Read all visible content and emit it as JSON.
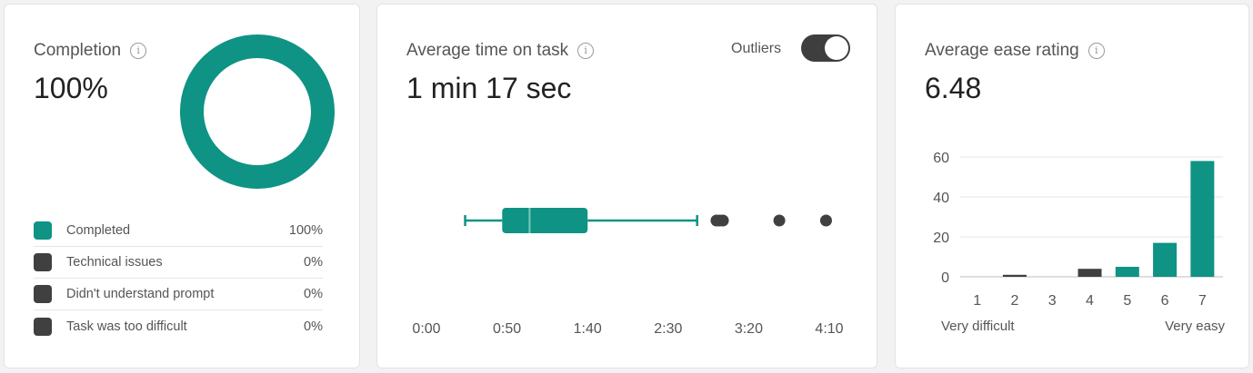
{
  "completion": {
    "title": "Completion",
    "value": "100%",
    "percent": 100,
    "legend": [
      {
        "label": "Completed",
        "value": "100%",
        "color": "#0e9384"
      },
      {
        "label": "Technical issues",
        "value": "0%",
        "color": "#404040"
      },
      {
        "label": "Didn't understand prompt",
        "value": "0%",
        "color": "#404040"
      },
      {
        "label": "Task was too difficult",
        "value": "0%",
        "color": "#404040"
      }
    ]
  },
  "time": {
    "title": "Average time on task",
    "value": "1 min 17 sec",
    "outliers_label": "Outliers",
    "outliers_on": true
  },
  "ease": {
    "title": "Average ease rating",
    "value": "6.48",
    "low_label": "Very difficult",
    "high_label": "Very easy"
  },
  "colors": {
    "teal": "#0e9384",
    "dark": "#404040"
  },
  "chart_data": [
    {
      "type": "box",
      "x_tick_labels": [
        "0:00",
        "0:50",
        "1:40",
        "2:30",
        "3:20",
        "4:10"
      ],
      "x_tick_values": [
        0,
        50,
        100,
        150,
        200,
        250
      ],
      "xlim": [
        0,
        250
      ],
      "box": {
        "whisker_low": 24,
        "q1": 47,
        "median": 64,
        "q3": 100,
        "whisker_high": 168
      },
      "outliers": [
        180,
        182,
        184,
        219,
        248
      ]
    },
    {
      "type": "bar",
      "categories": [
        "1",
        "2",
        "3",
        "4",
        "5",
        "6",
        "7"
      ],
      "values": [
        0,
        1,
        0,
        4,
        5,
        17,
        58
      ],
      "bar_colors": [
        "#404040",
        "#404040",
        "#404040",
        "#404040",
        "#0e9384",
        "#0e9384",
        "#0e9384"
      ],
      "y_tick_labels": [
        "0",
        "20",
        "40",
        "60"
      ],
      "ylim": [
        0,
        60
      ]
    }
  ]
}
